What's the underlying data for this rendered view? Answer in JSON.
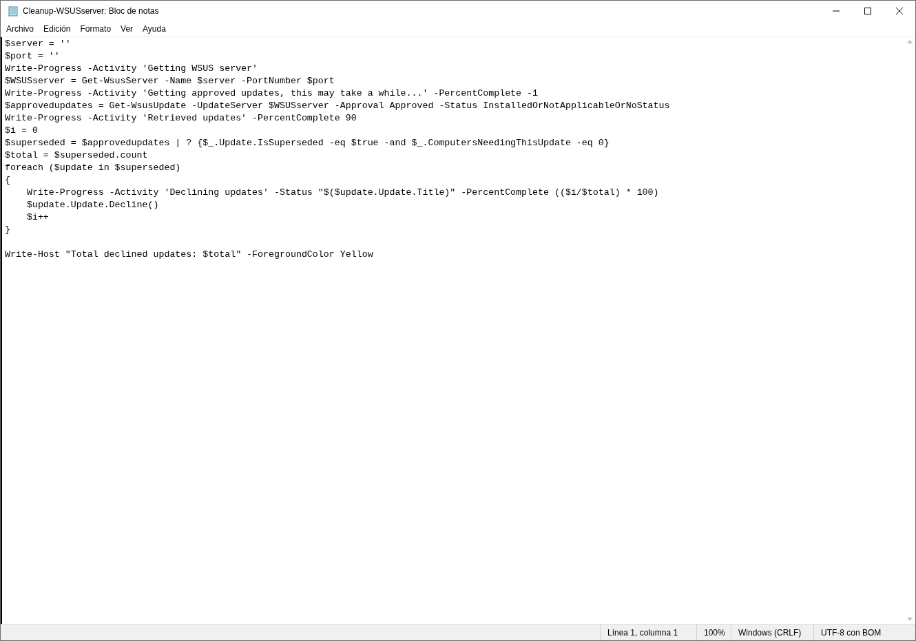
{
  "window": {
    "title": "Cleanup-WSUSserver: Bloc de notas"
  },
  "menu": [
    "Archivo",
    "Edición",
    "Formato",
    "Ver",
    "Ayuda"
  ],
  "editor": {
    "text": "$server = ''\n$port = ''\nWrite-Progress -Activity 'Getting WSUS server'\n$WSUSserver = Get-WsusServer -Name $server -PortNumber $port\nWrite-Progress -Activity 'Getting approved updates, this may take a while...' -PercentComplete -1\n$approvedupdates = Get-WsusUpdate -UpdateServer $WSUSserver -Approval Approved -Status InstalledOrNotApplicableOrNoStatus\nWrite-Progress -Activity 'Retrieved updates' -PercentComplete 90\n$i = 0\n$superseded = $approvedupdates | ? {$_.Update.IsSuperseded -eq $true -and $_.ComputersNeedingThisUpdate -eq 0}\n$total = $superseded.count\nforeach ($update in $superseded)\n{\n    Write-Progress -Activity 'Declining updates' -Status \"$($update.Update.Title)\" -PercentComplete (($i/$total) * 100)\n    $update.Update.Decline()\n    $i++\n}\n\nWrite-Host \"Total declined updates: $total\" -ForegroundColor Yellow"
  },
  "status_bar": [
    "Línea 1, columna 1",
    "100%",
    "Windows (CRLF)",
    "UTF-8 con BOM"
  ]
}
